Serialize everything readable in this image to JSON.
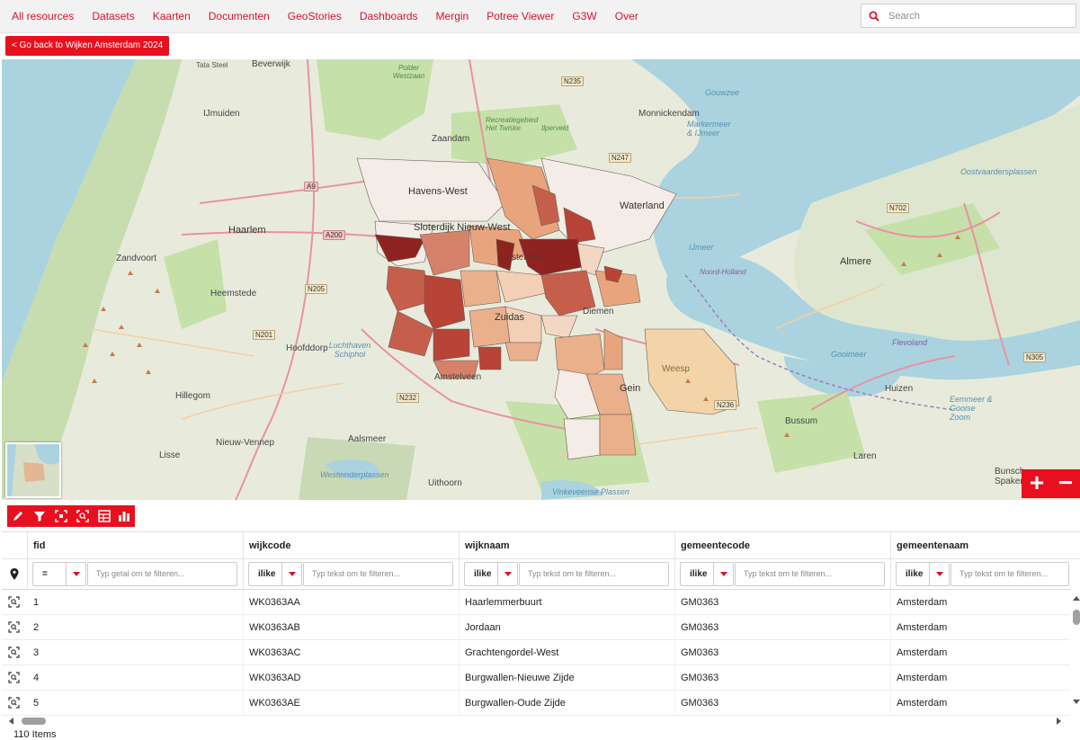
{
  "nav": {
    "items": [
      "All resources",
      "Datasets",
      "Kaarten",
      "Documenten",
      "GeoStories",
      "Dashboards",
      "Mergin",
      "Potree Viewer",
      "G3W",
      "Over"
    ],
    "search_placeholder": "Search"
  },
  "back_button": "< Go back to Wijken Amsterdam 2024",
  "map": {
    "labels": {
      "havens_west": "Havens-West",
      "sloterdijk": "Sloterdijk Nieuw-West",
      "waterland": "Waterland",
      "zuidas": "Zuidas",
      "amsterdam": "Amsterdam",
      "haarlem": "Haarlem",
      "almere": "Almere",
      "ijmuiden": "IJmuiden",
      "beverwijk": "Beverwijk",
      "zaandam": "Zaandam",
      "monnickendam": "Monnickendam",
      "zandvoort": "Zandvoort",
      "heemstede": "Heemstede",
      "hoofddorp": "Hoofddorp",
      "hillegom": "Hillegom",
      "nieuw_vennep": "Nieuw-Vennep",
      "lisse": "Lisse",
      "amstelveen": "Amstelveen",
      "aalsmeer": "Aalsmeer",
      "uithoorn": "Uithoorn",
      "gein": "Gein",
      "weesp": "Weesp",
      "bussum": "Bussum",
      "huizen": "Huizen",
      "laren": "Laren",
      "bunschoten": "Bunsch Spaker",
      "diemen": "Diemen",
      "schiphol": "Luchthaven Schiphol",
      "tata_steel": "Tata Steel",
      "polder": "Polder Westzaan",
      "markermeer": "Markermeer & IJmeer",
      "oostvaardersplassen": "Oostvaardersplassen",
      "recreatiegebied": "Recreatiegebied Het Twiske",
      "ilperveld": "Ilperveld",
      "ijmeer": "IJmeer",
      "gouwzee": "Gouwzee",
      "gooimeer": "Gooimeer",
      "eemmeer": "Eemmeer & Gooise Zoom",
      "westeinder": "Westeinderplassen",
      "vinkeveense": "Vinkeveense Plassen",
      "flevoland": "Flevoland",
      "noord_holland": "Noord-Holland"
    },
    "roads": [
      "N235",
      "N247",
      "A9",
      "A200",
      "N205",
      "N201",
      "N232",
      "N702",
      "N305",
      "N236"
    ],
    "zoom_in": "+",
    "zoom_out": "−"
  },
  "toolbar": {
    "icons": [
      "pencil-icon",
      "filter-icon",
      "zoom-to-selection-icon",
      "zoom-to-filter-icon",
      "table-settings-icon",
      "chart-icon"
    ]
  },
  "table": {
    "columns": [
      {
        "title": "fid",
        "op": "=",
        "placeholder": "Typ getal om te filteren..."
      },
      {
        "title": "wijkcode",
        "op": "ilike",
        "placeholder": "Typ tekst om te filteren..."
      },
      {
        "title": "wijknaam",
        "op": "ilike",
        "placeholder": "Typ tekst om te filteren..."
      },
      {
        "title": "gemeentecode",
        "op": "ilike",
        "placeholder": "Typ tekst om te filteren..."
      },
      {
        "title": "gemeentenaam",
        "op": "ilike",
        "placeholder": "Typ tekst om te filteren..."
      }
    ],
    "rows": [
      [
        "1",
        "WK0363AA",
        "Haarlemmerbuurt",
        "GM0363",
        "Amsterdam"
      ],
      [
        "2",
        "WK0363AB",
        "Jordaan",
        "GM0363",
        "Amsterdam"
      ],
      [
        "3",
        "WK0363AC",
        "Grachtengordel-West",
        "GM0363",
        "Amsterdam"
      ],
      [
        "4",
        "WK0363AD",
        "Burgwallen-Nieuwe Zijde",
        "GM0363",
        "Amsterdam"
      ],
      [
        "5",
        "WK0363AE",
        "Burgwallen-Oude Zijde",
        "GM0363",
        "Amsterdam"
      ]
    ],
    "footer": "110 Items"
  },
  "colors": {
    "accent": "#e8101e",
    "link": "#d9122b"
  }
}
